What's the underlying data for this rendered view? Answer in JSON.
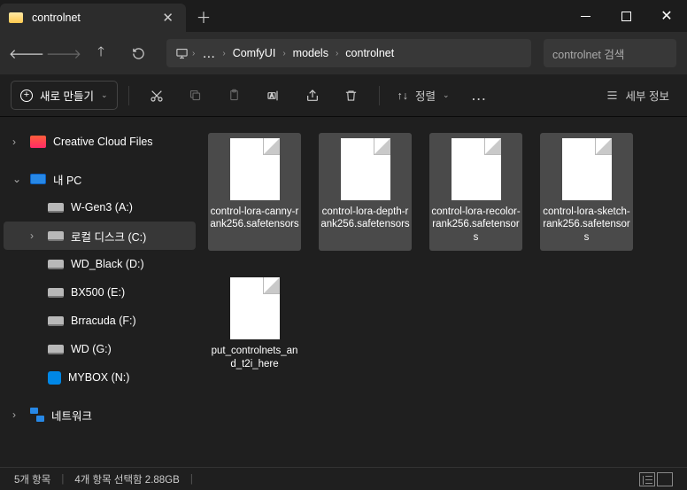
{
  "titlebar": {
    "tab_title": "controlnet"
  },
  "breadcrumb": {
    "overflow": "…",
    "s1": "ComfyUI",
    "s2": "models",
    "s3": "controlnet"
  },
  "search": {
    "placeholder": "controlnet 검색"
  },
  "toolbar": {
    "new_label": "새로 만들기",
    "sort_label": "정렬",
    "view_label": "세부 정보"
  },
  "sidebar": {
    "cc": "Creative Cloud Files",
    "pc": "내 PC",
    "d0": "W-Gen3 (A:)",
    "d1": "로컬 디스크 (C:)",
    "d2": "WD_Black (D:)",
    "d3": "BX500 (E:)",
    "d4": "Brracuda (F:)",
    "d5": "WD (G:)",
    "d6": "MYBOX (N:)",
    "net": "네트워크"
  },
  "files": {
    "f0": "control-lora-canny-rank256.safetensors",
    "f1": "control-lora-depth-rank256.safetensors",
    "f2": "control-lora-recolor-rank256.safetensors",
    "f3": "control-lora-sketch-rank256.safetensors",
    "f4": "put_controlnets_and_t2i_here"
  },
  "status": {
    "count": "5개 항목",
    "selected": "4개 항목 선택함 2.88GB"
  }
}
